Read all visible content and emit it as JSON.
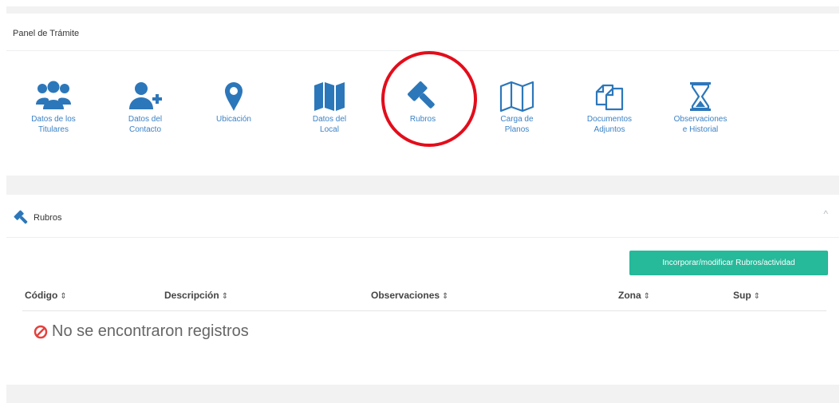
{
  "panel": {
    "title": "Panel de Trámite"
  },
  "nav": {
    "items": [
      {
        "line1": "Datos de los",
        "line2": "Titulares",
        "icon": "users-icon"
      },
      {
        "line1": "Datos del",
        "line2": "Contacto",
        "icon": "user-plus-icon"
      },
      {
        "line1": "Ubicación",
        "line2": "",
        "icon": "map-marker-icon"
      },
      {
        "line1": "Datos del",
        "line2": "Local",
        "icon": "map-icon"
      },
      {
        "line1": "Rubros",
        "line2": "",
        "icon": "gavel-icon"
      },
      {
        "line1": "Carga de",
        "line2": "Planos",
        "icon": "map-outline-icon"
      },
      {
        "line1": "Documentos",
        "line2": "Adjuntos",
        "icon": "documents-icon"
      },
      {
        "line1": "Observaciones",
        "line2": "e Historial",
        "icon": "hourglass-icon"
      }
    ]
  },
  "section": {
    "title": "Rubros",
    "icon": "gavel-icon",
    "collapse_symbol": "^"
  },
  "action": {
    "label": "Incorporar/modificar Rubros/actividad"
  },
  "table": {
    "sort_symbol": "⇕",
    "columns": [
      "Código",
      "Descripción",
      "Observaciones",
      "Zona",
      "Sup"
    ],
    "empty_message": "No se encontraron registros"
  },
  "colors": {
    "icon": "#2c77ba",
    "label": "#3c82c4",
    "accent_button": "#26b99a",
    "highlight_circle": "#e30d1b",
    "empty_icon": "#e5413d"
  }
}
